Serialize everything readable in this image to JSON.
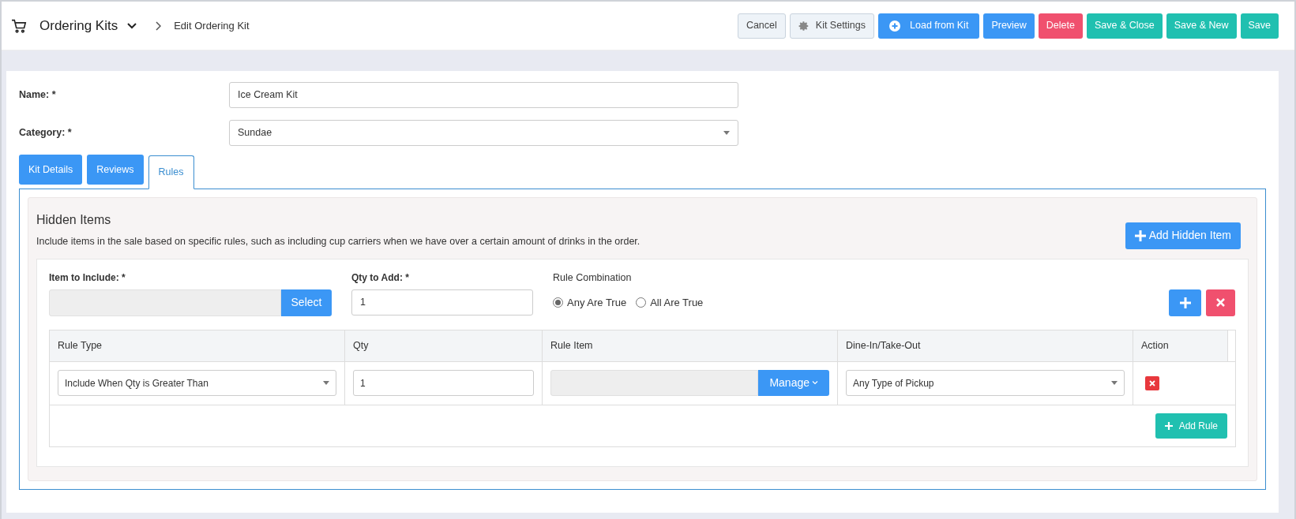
{
  "header": {
    "title": "Ordering Kits",
    "breadcrumb": "Edit Ordering Kit"
  },
  "actions": [
    {
      "label": "Cancel",
      "kind": "light"
    },
    {
      "label": "Kit Settings",
      "kind": "settings"
    },
    {
      "label": "Load from Kit",
      "kind": "load"
    },
    {
      "label": "Preview",
      "kind": "primary"
    },
    {
      "label": "Delete",
      "kind": "danger"
    },
    {
      "label": "Save & Close",
      "kind": "success"
    },
    {
      "label": "Save & New",
      "kind": "success"
    },
    {
      "label": "Save",
      "kind": "success"
    }
  ],
  "fields": [
    {
      "label": "Name: *",
      "value": "Ice Cream Kit",
      "kind": "text"
    },
    {
      "label": "Category: *",
      "value": "Sundae",
      "kind": "select"
    }
  ],
  "tabs": [
    {
      "label": "Kit Details",
      "selected": false
    },
    {
      "label": "Reviews",
      "selected": false
    },
    {
      "label": "Rules",
      "selected": true
    }
  ],
  "hidden_items": {
    "title": "Hidden Items",
    "description": "Include items in the sale based on specific rules, such as including cup carriers when we have over a certain amount of drinks in the order.",
    "add_button": "Add Hidden Item",
    "item_to_include": {
      "label": "Item to Include: *",
      "button": "Select"
    },
    "qty_to_add": {
      "label": "Qty to Add: *",
      "value": "1"
    },
    "rule_combination": {
      "label": "Rule Combination",
      "options": [
        {
          "label": "Any Are True",
          "selected": true
        },
        {
          "label": "All Are True",
          "selected": false
        }
      ]
    },
    "rules_table": {
      "columns": [
        "Rule Type",
        "Qty",
        "Rule Item",
        "Dine-In/Take-Out",
        "Action"
      ],
      "rows": [
        {
          "rule_type": "Include When Qty is Greater Than",
          "qty": "1",
          "rule_item_button": "Manage",
          "pickup": "Any Type of Pickup"
        }
      ]
    },
    "add_rule": "Add Rule"
  }
}
